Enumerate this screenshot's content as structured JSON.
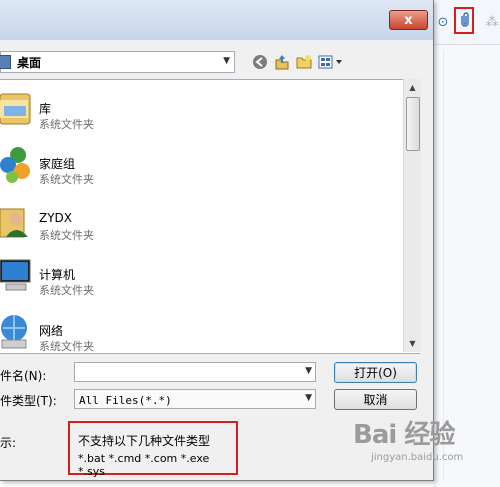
{
  "dialog": {
    "close_label": "x",
    "address": {
      "current": "桌面"
    },
    "items": [
      {
        "name": "库",
        "sub": "系统文件夹",
        "icon": "library-icon"
      },
      {
        "name": "家庭组",
        "sub": "系统文件夹",
        "icon": "homegroup-icon"
      },
      {
        "name": "ZYDX",
        "sub": "系统文件夹",
        "icon": "user-folder-icon"
      },
      {
        "name": "计算机",
        "sub": "系统文件夹",
        "icon": "computer-icon"
      },
      {
        "name": "网络",
        "sub": "系统文件夹",
        "icon": "network-icon"
      }
    ],
    "filename_label": "件名(N):",
    "filename_value": "",
    "filetype_label": "件类型(T):",
    "filetype_value": "All Files(*.*)",
    "open_button": "打开(O)",
    "cancel_button": "取消",
    "hint_label": "示:",
    "hint_line1": "不支持以下几种文件类型",
    "hint_line2": "*.bat *.cmd *.com *.exe *.sys"
  },
  "background_toolbar": {
    "icons": [
      "link-icon",
      "attachment-icon"
    ]
  },
  "watermark": {
    "text": "Bai 经验",
    "url": "jingyan.baidu.com"
  },
  "colors": {
    "highlight": "#d61f1f",
    "titlebar": "#c6d5ea",
    "close": "#c9452d"
  }
}
